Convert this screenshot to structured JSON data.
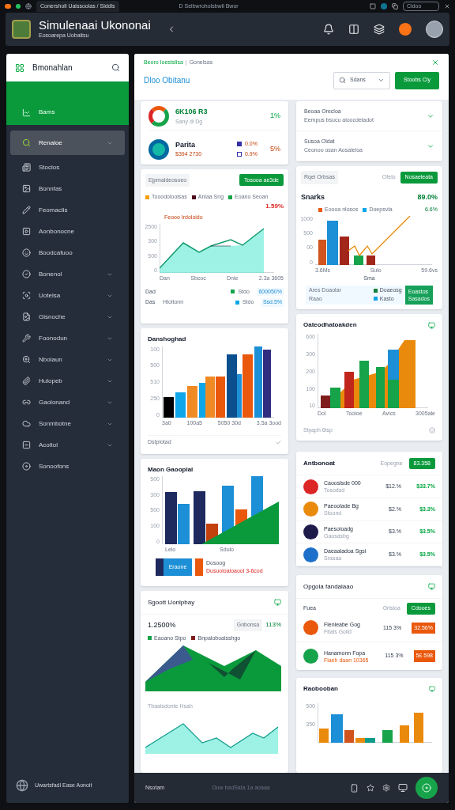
{
  "browser": {
    "tabs": [
      {
        "label": "Conersholl Uaissoolas / Siddls",
        "selected": true
      }
    ],
    "address": "D Selbwroholsbwil Bwor",
    "search": "Cidoo"
  },
  "header": {
    "title": "Simulenaai Ukononai",
    "subtitle": "Eosoarepa Uobaitsu"
  },
  "sidebar": {
    "title": "Bmonahlan",
    "section": "Bams",
    "items": [
      {
        "label": "Renaloe",
        "selected": true,
        "expandable": true
      },
      {
        "label": "Stoclos",
        "selected": false,
        "expandable": false
      },
      {
        "label": "Bonnfas",
        "selected": false,
        "expandable": false
      },
      {
        "label": "Feomaclis",
        "selected": false,
        "expandable": false
      },
      {
        "label": "Aonbonocne",
        "selected": false,
        "expandable": false
      },
      {
        "label": "Boodcafuoo",
        "selected": false,
        "expandable": false
      },
      {
        "label": "Bonenol",
        "selected": false,
        "expandable": true
      },
      {
        "label": "Uotelsa",
        "selected": false,
        "expandable": true
      },
      {
        "label": "Gisnoche",
        "selected": false,
        "expandable": true
      },
      {
        "label": "Foonodun",
        "selected": false,
        "expandable": true
      },
      {
        "label": "Nbolaun",
        "selected": false,
        "expandable": true
      },
      {
        "label": "Hulopeb",
        "selected": false,
        "expandable": true
      },
      {
        "label": "Gaolonand",
        "selected": false,
        "expandable": true
      },
      {
        "label": "Sonmbotne",
        "selected": false,
        "expandable": true
      },
      {
        "label": "Acoltol",
        "selected": false,
        "expandable": true
      },
      {
        "label": "Sonoofons",
        "selected": false,
        "expandable": false
      }
    ],
    "footer": "Uwartsfadl Ease Aonoit"
  },
  "main": {
    "breadcrumb": "Beoro Ioestslisa",
    "breadcrumb_separator": "|",
    "breadcrumb_tail": "Gonelsas",
    "title": "Dloo Obitanu",
    "filter": "Sdans",
    "action": "Stoobs Cly"
  },
  "stats": [
    {
      "kind": "metric",
      "value": "6K106 R3",
      "sub": "Sany di Dg",
      "pct": "1%"
    },
    {
      "kind": "split",
      "value": "Parita",
      "sub": "$394 2730",
      "figures": [
        {
          "label": "0.0%",
          "checked": true
        },
        {
          "label": "0.9%",
          "checked": false
        }
      ],
      "pct": "5%"
    }
  ],
  "accordion": [
    {
      "title": "Beoaa Orecloa",
      "sub": "Eempus bsucu aloocdeladot"
    },
    {
      "title": "Susoa Oldat",
      "sub": "Ceonoo osan Aosaleloa"
    }
  ],
  "trend_card": {
    "chip": "Ejpmaldeosoeo",
    "button": "Tosooa ae3de",
    "legend": [
      {
        "label": "Tooodoloolsas",
        "color": "#f59e0b"
      },
      {
        "label": "Aniaa Sng",
        "color": "#4c0519"
      },
      {
        "label": "Eoano Seoan",
        "color": "#16a34a"
      }
    ],
    "figure": "1.59%",
    "chart_title": "Feooo Irdoloido",
    "yticks": [
      "2500",
      "300",
      "500",
      "0"
    ],
    "xlabels": [
      "Dan",
      "Sbcoc",
      "Dnie",
      "2.3a 3605"
    ],
    "rows": [
      {
        "label": "Dad",
        "key": "Stdo",
        "value": "600050%",
        "color": "#16a34a"
      },
      {
        "label": "Das",
        "note": "Htoltonn",
        "key": "Stdo",
        "value": "Ssd.5%",
        "color": "#0ea5e9"
      }
    ]
  },
  "combo_card": {
    "chip": "Rqei Orbsas",
    "hint": "Ofelo",
    "button": "Nosaeleata",
    "title": "Snarks",
    "pct": "89.0%",
    "legend": [
      {
        "label": "Eoooa nlosos",
        "color": "#ea580c"
      },
      {
        "label": "Doepsvla",
        "color": "#0ea5e9"
      }
    ],
    "line_pct": "6.6%",
    "yticks": [
      "1000",
      "500",
      "00",
      "0"
    ],
    "xlabels": [
      "3.6Ms",
      "Sulo",
      "59.6vs"
    ],
    "xtitle": "Sma",
    "strip": {
      "label": "Ares Doaolar",
      "sub": "Raao",
      "keys": [
        {
          "label": "Doaeosg",
          "color": "#15803d"
        },
        {
          "label": "Kasto",
          "color": "#0ea5e9"
        }
      ],
      "highlight": [
        "Eoastos",
        "Sasados"
      ]
    }
  },
  "bars_card": {
    "title": "Danshoghad",
    "yticks": [
      "100",
      "500",
      "510",
      "250",
      "0"
    ],
    "xlabels": [
      "3a0",
      "100a5",
      "5050 30d",
      "3.5a 3ood"
    ],
    "footer": "Dstplotad"
  },
  "growth_card": {
    "title": "Oateodhatoakden",
    "yticks": [
      "600",
      "300",
      "200",
      "100",
      "10"
    ],
    "xlabels": [
      "Dol",
      "Tooloe",
      "Avics",
      "3005ale"
    ],
    "footer": "Styaph 6tsp"
  },
  "mix_card": {
    "title": "Maon Gaooplal",
    "yticks": [
      "500",
      "300",
      "500",
      "100",
      "0"
    ],
    "xlabels": [
      "Lelo",
      "Sdulo"
    ],
    "swatch": "Eraone",
    "legend_title": "Dosoog",
    "legend_text": "Dusuoloaloaool 3-6cod"
  },
  "ranking_card": {
    "title": "Antbonoat",
    "hint": "Eopegne",
    "badge": "83.358",
    "rows": [
      {
        "title": "Caooslsde 000",
        "sub": "Tosodsd",
        "a": "$12.%",
        "b": "$33.7%",
        "color": "#dc2626"
      },
      {
        "title": "Paeoolade Bg",
        "sub": "Stoond",
        "a": "$2.%",
        "b": "$3.3%",
        "color": "#ea8a0c"
      },
      {
        "title": "Paesoloadg",
        "sub": "Gaosasbg",
        "a": "$3.%",
        "b": "$3.5%",
        "color": "#1e1b4b"
      },
      {
        "title": "Daeaaladoa Sgsi",
        "sub": "Srasaa",
        "a": "$3.%",
        "b": "$3.5%",
        "color": "#1d70c9"
      }
    ]
  },
  "peaks_card": {
    "title": "Sgoott Uonlpbay",
    "value": "1.2500%",
    "chip": "Gnbonsa",
    "pct": "113%",
    "legend": [
      {
        "label": "Eaoano Stpo",
        "color": "#16a34a"
      },
      {
        "label": "Bnpaloboalsshgo",
        "color": "#7f1d1d"
      }
    ],
    "subtitle": "Tbaalsdonte Hsah"
  },
  "offers_card": {
    "title": "Opgola fandalaao",
    "label": "Fuea",
    "hint": "Orlsloa",
    "badge": "Cdooes",
    "rows": [
      {
        "title": "Flenleabe Gog",
        "sub": "Fitals Goild",
        "a": "115 3%",
        "b": "32.56%",
        "color": "#ea580c"
      },
      {
        "title": "Hanamonn Fopa",
        "sub": "Fiaeh daan 10365",
        "a": "115 3%",
        "b": "5£ 598",
        "color": "#16a34a"
      }
    ]
  },
  "last_card": {
    "title": "Raobooban",
    "yticks": [
      "500",
      "350"
    ]
  },
  "bottom_bar": {
    "label": "Nsotam",
    "status": "Ouw badSata 1a aoaaa"
  }
}
